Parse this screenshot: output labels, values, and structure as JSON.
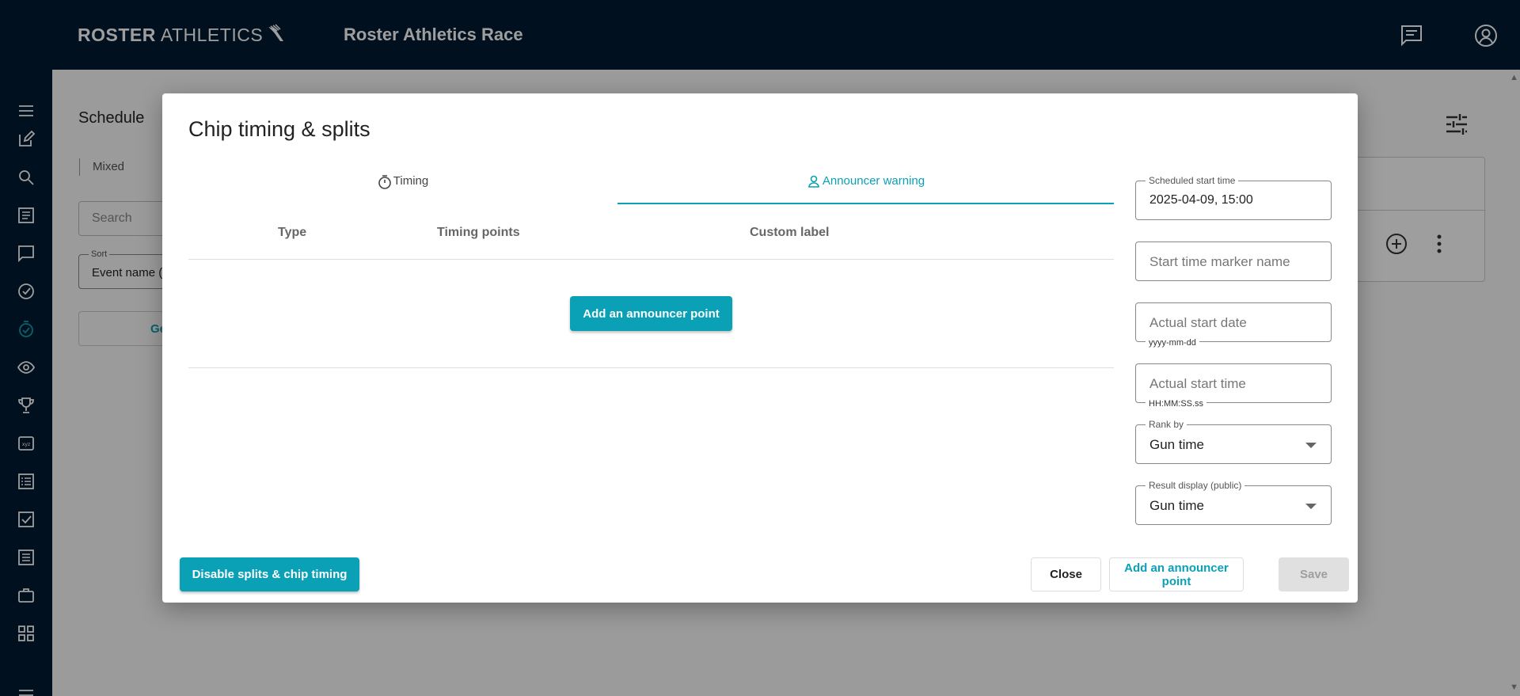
{
  "topbar": {
    "brand_bold": "ROSTER",
    "brand_light": "ATHLETICS",
    "app_title": "Roster Athletics Race",
    "icons": [
      "chat-icon",
      "account-icon"
    ]
  },
  "sidebar": {
    "icons": [
      "menu-icon",
      "edit-icon",
      "search-icon",
      "list-icon",
      "chat-icon",
      "check-circle-icon",
      "timer-check-icon",
      "eye-icon",
      "trophy-icon",
      "xyz-icon",
      "list-detail-icon",
      "checkbox-icon",
      "document-icon",
      "briefcase-icon",
      "grid-icon"
    ]
  },
  "background": {
    "title": "Schedule",
    "tab": "Mixed",
    "search_placeholder": "Search",
    "sort_label": "Sort",
    "sort_value": "Event name (",
    "generate_label": "Ge"
  },
  "dialog": {
    "title": "Chip timing & splits",
    "tabs": [
      {
        "label": "Timing",
        "icon": "stopwatch-icon",
        "active": false
      },
      {
        "label": "Announcer warning",
        "icon": "person-icon",
        "active": true
      }
    ],
    "table_headers": [
      "Type",
      "Timing points",
      "Custom label"
    ],
    "add_point_label": "Add an announcer point",
    "fields": {
      "scheduled_start": {
        "label": "Scheduled start time",
        "value": "2025-04-09, 15:00"
      },
      "marker_name": {
        "placeholder": "Start time marker name"
      },
      "actual_date": {
        "placeholder": "Actual start date",
        "hint": "yyyy-mm-dd"
      },
      "actual_time": {
        "placeholder": "Actual start time",
        "hint": "HH:MM:SS.ss"
      },
      "rank_by": {
        "label": "Rank by",
        "value": "Gun time"
      },
      "result_display": {
        "label": "Result display (public)",
        "value": "Gun time"
      }
    },
    "footer": {
      "disable": "Disable splits & chip timing",
      "close": "Close",
      "add_point": "Add an announcer point",
      "save": "Save"
    }
  },
  "colors": {
    "accent": "#0aa0b5",
    "navy": "#021b33"
  }
}
